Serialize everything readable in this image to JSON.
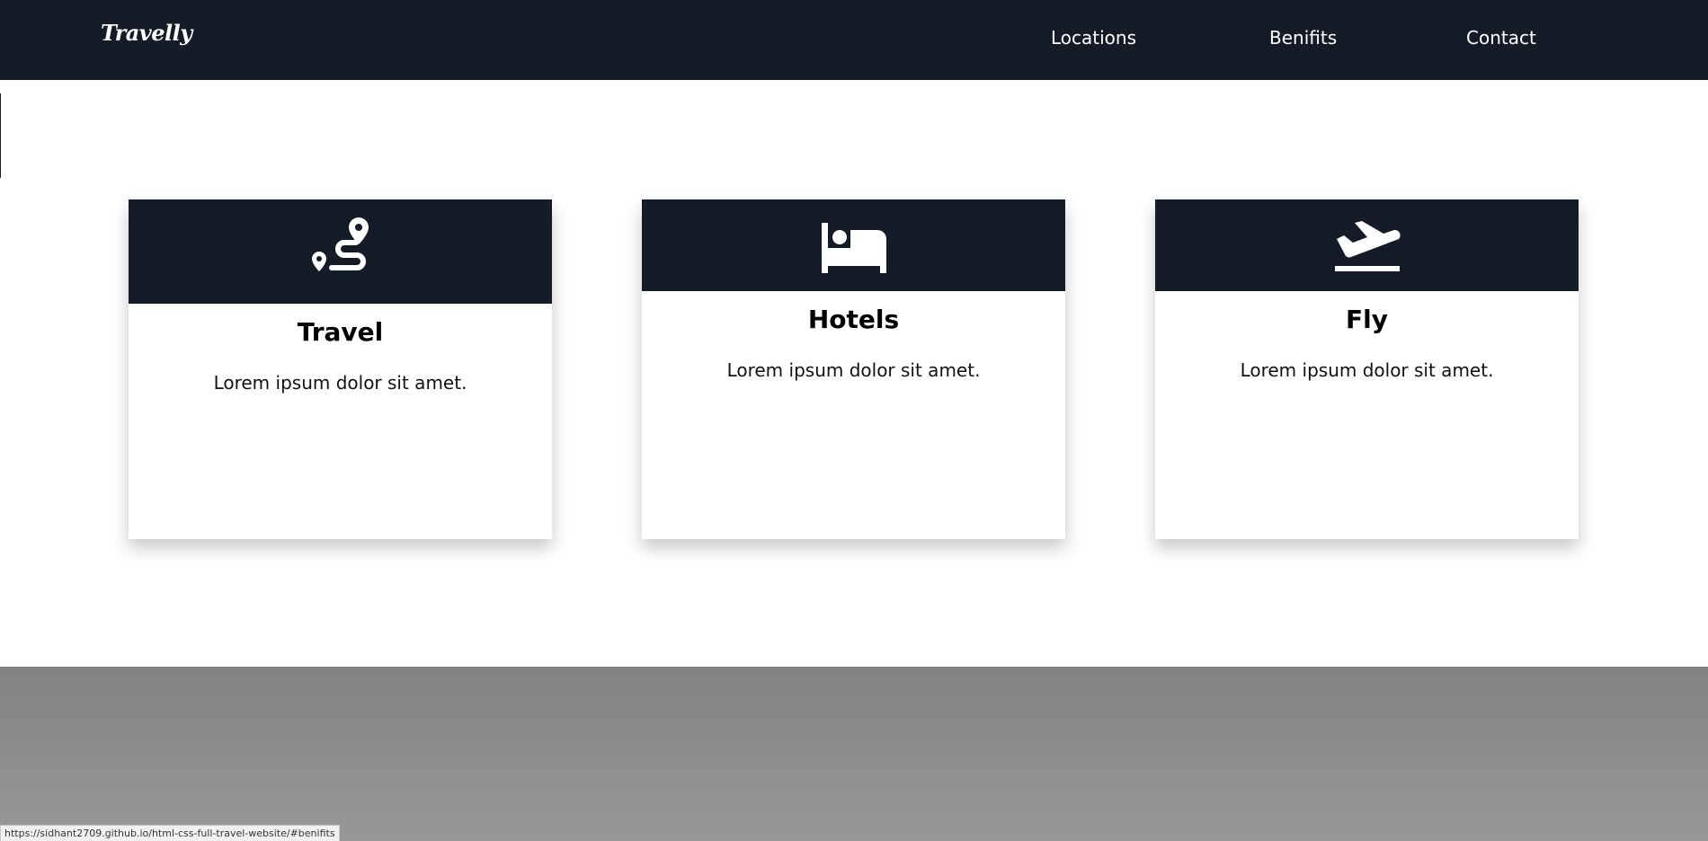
{
  "navbar": {
    "logo": "Travelly",
    "links": [
      {
        "label": "Locations"
      },
      {
        "label": "Benifits"
      },
      {
        "label": "Contact"
      }
    ]
  },
  "cards": [
    {
      "icon": "route-icon",
      "title": "Travel",
      "text": "Lorem ipsum dolor sit amet."
    },
    {
      "icon": "bed-icon",
      "title": "Hotels",
      "text": "Lorem ipsum dolor sit amet."
    },
    {
      "icon": "plane-departure-icon",
      "title": "Fly",
      "text": "Lorem ipsum dolor sit amet."
    }
  ],
  "status_bar": {
    "url": "https://sidhant2709.github.io/html-css-full-travel-website/#benifits"
  },
  "colors": {
    "navbar_bg": "#151c27",
    "card_header_bg": "#151c27",
    "footer_band": "#8a8a8a"
  }
}
